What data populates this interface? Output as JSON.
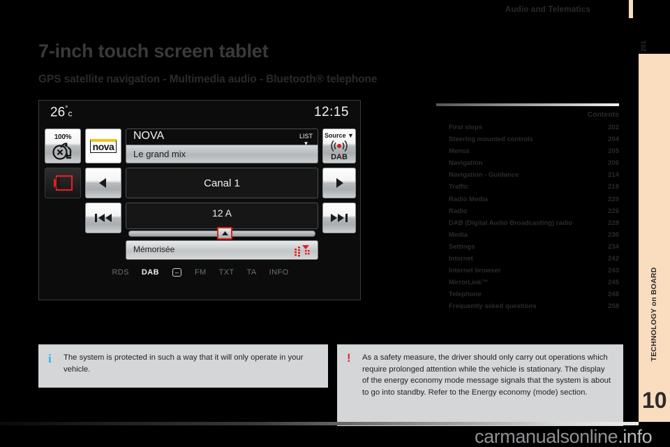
{
  "header": {
    "title": "Audio and Telematics",
    "page_number": "201"
  },
  "sidebar": {
    "chapter_label": "TECHNOLOGY on BOARD",
    "chapter_number": "10"
  },
  "headings": {
    "h1": "7-inch touch screen tablet",
    "h2": "GPS satellite navigation - Multimedia audio - Bluetooth® telephone"
  },
  "contents": {
    "title": "Contents",
    "items": [
      {
        "label": "First steps",
        "page": "202"
      },
      {
        "label": "Steering mounted controls",
        "page": "204"
      },
      {
        "label": "Menus",
        "page": "205"
      },
      {
        "label": "Navigation",
        "page": "206"
      },
      {
        "label": "Navigation - Guidance",
        "page": "214"
      },
      {
        "label": "Traffic",
        "page": "218"
      },
      {
        "label": "Radio Media",
        "page": "220"
      },
      {
        "label": "Radio",
        "page": "226"
      },
      {
        "label": "DAB (Digital Audio Broadcasting) radio",
        "page": "228"
      },
      {
        "label": "Media",
        "page": "230"
      },
      {
        "label": "Settings",
        "page": "234"
      },
      {
        "label": "Internet",
        "page": "242"
      },
      {
        "label": "Internet browser",
        "page": "243"
      },
      {
        "label": "MirrorLink™",
        "page": "245"
      },
      {
        "label": "Telephone",
        "page": "248"
      },
      {
        "label": "Frequently asked questions",
        "page": "258"
      }
    ]
  },
  "tablet": {
    "temperature": "26",
    "temp_unit_deg": "°",
    "temp_unit_c": "c",
    "clock": "12:15",
    "volume_percent": "100%",
    "station_logo": "nova",
    "station_name": "NOVA",
    "station_text": "Le grand mix",
    "list_label": "LIST",
    "source_label": "Source",
    "source_value": "DAB",
    "channel": "Canal 1",
    "frequency": "12 A",
    "memorised_label": "Mémorisée",
    "tags": [
      {
        "label": "RDS",
        "active": false
      },
      {
        "label": "DAB",
        "active": true
      },
      {
        "label": "FM",
        "active": false
      },
      {
        "label": "TXT",
        "active": false
      },
      {
        "label": "TA",
        "active": false
      },
      {
        "label": "INFO",
        "active": false
      }
    ]
  },
  "notes": {
    "info": {
      "marker": "i",
      "text": "The system is protected in such a way that it will only operate in your vehicle."
    },
    "warning": {
      "marker": "!",
      "text": "As a safety measure, the driver should only carry out operations which require prolonged attention while the vehicle is stationary. The display of the energy economy mode message signals that the system is about to go into standby. Refer to the Energy economy (mode) section."
    }
  },
  "watermark": {
    "main": "carmanualsonline",
    "suffix": ".info"
  },
  "colors": {
    "accent_peach": "#fadcbe",
    "info_blue": "#27b9e5",
    "warning_red": "#e32b2b",
    "highlight_red": "#e02020"
  }
}
